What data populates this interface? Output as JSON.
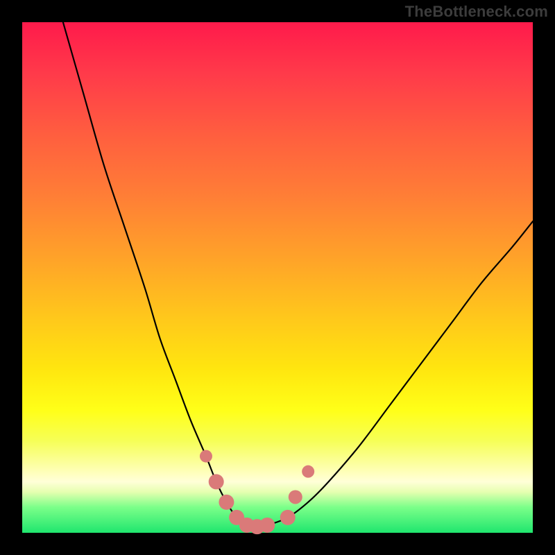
{
  "watermark": "TheBottleneck.com",
  "chart_data": {
    "type": "line",
    "title": "",
    "xlabel": "",
    "ylabel": "",
    "xlim": [
      0,
      100
    ],
    "ylim": [
      0,
      100
    ],
    "series": [
      {
        "name": "bottleneck-curve",
        "x": [
          8,
          12,
          16,
          20,
          24,
          27,
          30,
          33,
          36,
          38,
          40,
          42,
          44,
          46,
          48,
          52,
          56,
          60,
          66,
          72,
          78,
          84,
          90,
          96,
          100
        ],
        "y": [
          100,
          86,
          72,
          60,
          48,
          38,
          30,
          22,
          15,
          10,
          6,
          3,
          1.5,
          1.2,
          1.5,
          3,
          6,
          10,
          17,
          25,
          33,
          41,
          49,
          56,
          61
        ],
        "color": "#000000"
      }
    ],
    "markers": {
      "name": "highlight-dots",
      "color": "#da7a79",
      "points": [
        {
          "x": 36,
          "y": 15,
          "r": 9
        },
        {
          "x": 38,
          "y": 10,
          "r": 11
        },
        {
          "x": 40,
          "y": 6,
          "r": 11
        },
        {
          "x": 42,
          "y": 3,
          "r": 11
        },
        {
          "x": 44,
          "y": 1.5,
          "r": 11
        },
        {
          "x": 46,
          "y": 1.2,
          "r": 11
        },
        {
          "x": 48,
          "y": 1.5,
          "r": 11
        },
        {
          "x": 52,
          "y": 3,
          "r": 11
        },
        {
          "x": 53.5,
          "y": 7,
          "r": 10
        },
        {
          "x": 56,
          "y": 12,
          "r": 9
        }
      ]
    },
    "background_gradient": {
      "top": "#ff1a4b",
      "mid": "#ffe60f",
      "bottom": "#1fe66e"
    }
  }
}
